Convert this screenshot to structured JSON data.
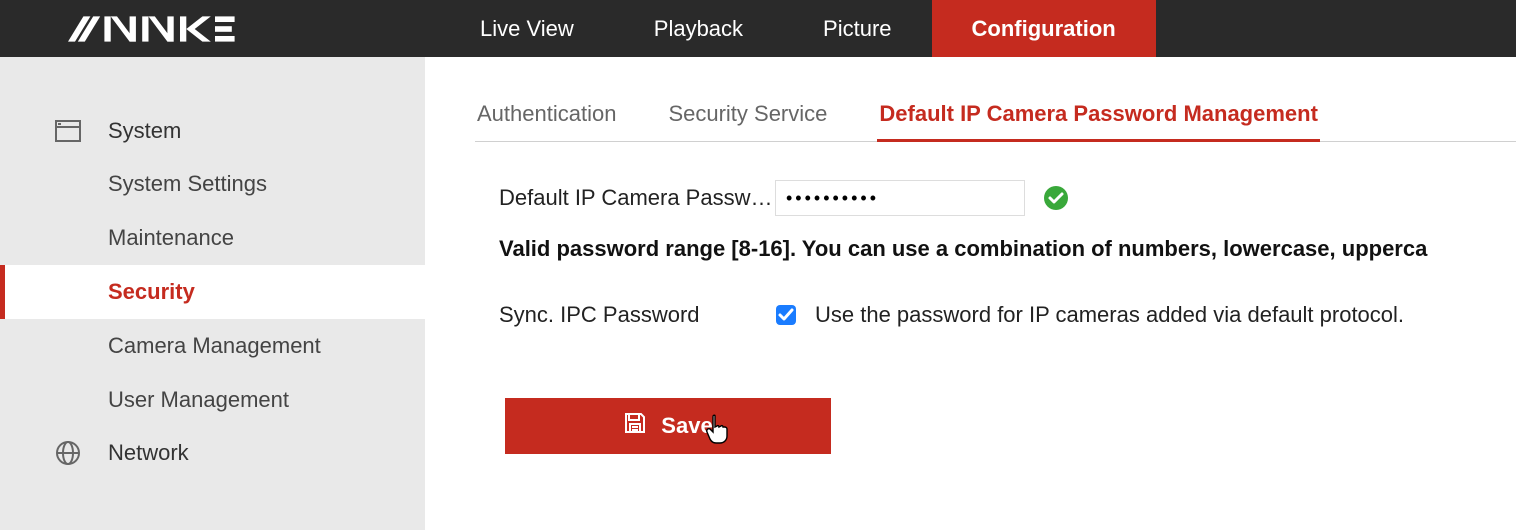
{
  "brand": "ANNKE",
  "topnav": {
    "items": [
      {
        "label": "Live View",
        "active": false
      },
      {
        "label": "Playback",
        "active": false
      },
      {
        "label": "Picture",
        "active": false
      },
      {
        "label": "Configuration",
        "active": true
      }
    ]
  },
  "sidebar": {
    "groups": [
      {
        "label": "System",
        "icon": "window-icon",
        "items": [
          {
            "label": "System Settings",
            "active": false
          },
          {
            "label": "Maintenance",
            "active": false
          },
          {
            "label": "Security",
            "active": true
          },
          {
            "label": "Camera Management",
            "active": false
          },
          {
            "label": "User Management",
            "active": false
          }
        ]
      },
      {
        "label": "Network",
        "icon": "globe-icon",
        "items": []
      }
    ]
  },
  "tabs": {
    "items": [
      {
        "label": "Authentication",
        "active": false
      },
      {
        "label": "Security Service",
        "active": false
      },
      {
        "label": "Default IP Camera Password Management",
        "active": true
      }
    ]
  },
  "form": {
    "password_label": "Default IP Camera Passw…",
    "password_value": "••••••••••",
    "password_valid": true,
    "hint": "Valid password range [8-16]. You can use a combination of numbers, lowercase, upperca",
    "sync_label": "Sync. IPC Password",
    "sync_checked": true,
    "sync_desc": "Use the password for IP cameras added via default protocol.",
    "save_label": "Save"
  },
  "colors": {
    "accent": "#c52b1f",
    "topbar": "#2a2a2a",
    "sidebar": "#e9e9e9"
  }
}
